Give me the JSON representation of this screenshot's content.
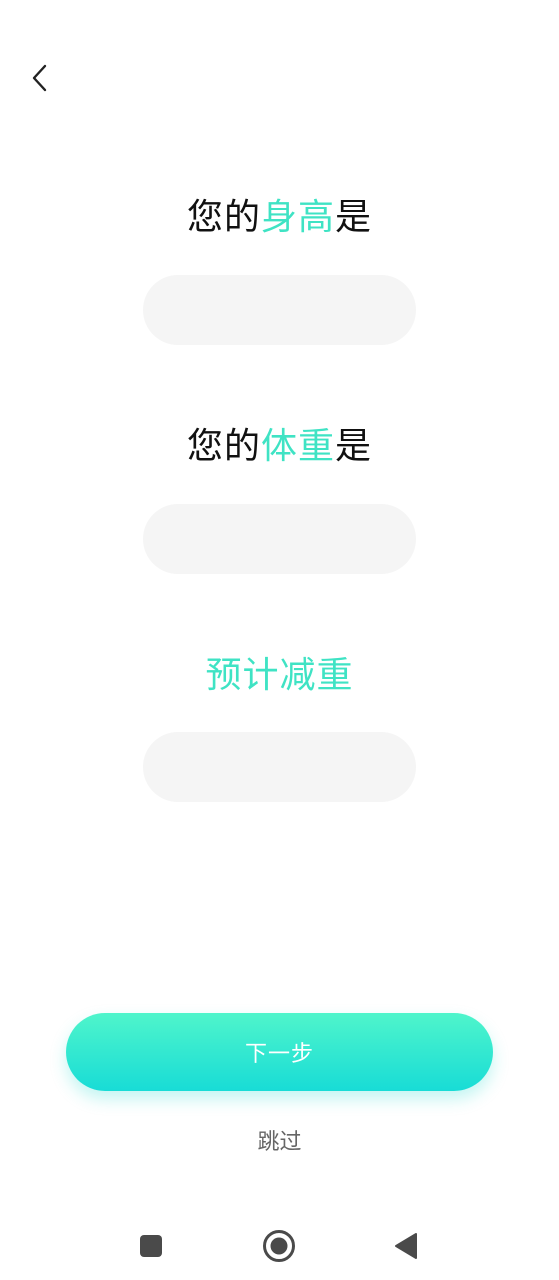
{
  "header": {
    "back_icon": "chevron-left-icon"
  },
  "height_question": {
    "prefix": "您的",
    "highlight": "身高",
    "suffix": "是"
  },
  "height_input": {
    "value": "",
    "placeholder": ""
  },
  "weight_question": {
    "prefix": "您的",
    "highlight": "体重",
    "suffix": "是"
  },
  "weight_input": {
    "value": "",
    "placeholder": ""
  },
  "goal_question": {
    "label": "预计减重"
  },
  "goal_input": {
    "value": "",
    "placeholder": ""
  },
  "actions": {
    "next_label": "下一步",
    "skip_label": "跳过"
  },
  "system_nav": {
    "recents_icon": "square-icon",
    "home_icon": "circle-icon",
    "back_icon": "triangle-back-icon"
  },
  "colors": {
    "accent": "#3fe3c4",
    "button_gradient_top": "#4ff5cb",
    "button_gradient_bottom": "#18dcd6",
    "input_bg": "#f5f5f5"
  }
}
